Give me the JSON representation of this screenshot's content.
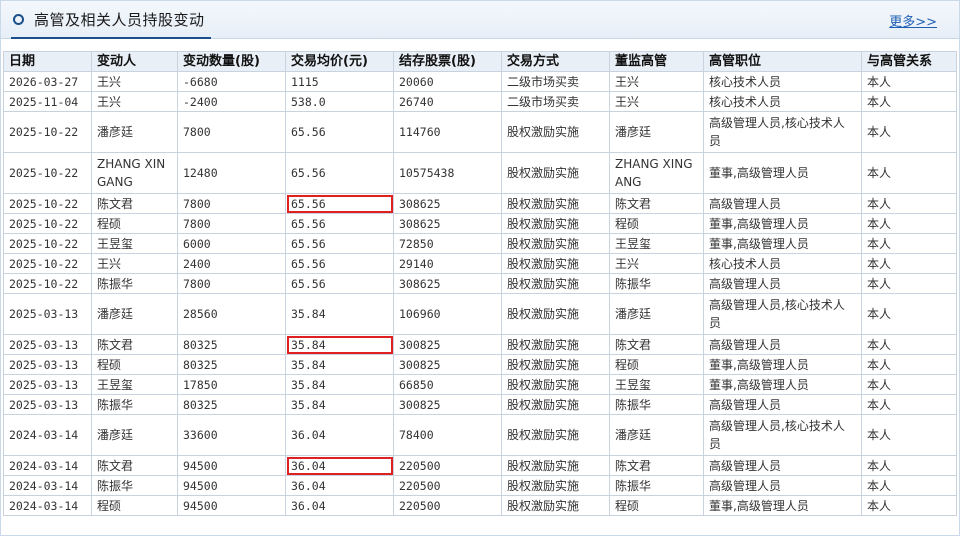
{
  "panel": {
    "title": "高管及相关人员持股变动",
    "more_label": "更多>>"
  },
  "table": {
    "headers": [
      "日期",
      "变动人",
      "变动数量(股)",
      "交易均价(元)",
      "结存股票(股)",
      "交易方式",
      "董监高管",
      "高管职位",
      "与高管关系"
    ],
    "rows": [
      [
        "2026-03-27",
        "王兴",
        "-6680",
        "1115",
        "20060",
        "二级市场买卖",
        "王兴",
        "核心技术人员",
        "本人"
      ],
      [
        "2025-11-04",
        "王兴",
        "-2400",
        "538.0",
        "26740",
        "二级市场买卖",
        "王兴",
        "核心技术人员",
        "本人"
      ],
      [
        "2025-10-22",
        "潘彦廷",
        "7800",
        "65.56",
        "114760",
        "股权激励实施",
        "潘彦廷",
        "高级管理人员,核心技术人员",
        "本人"
      ],
      [
        "2025-10-22",
        "ZHANG XINGANG",
        "12480",
        "65.56",
        "10575438",
        "股权激励实施",
        "ZHANG XINGANG",
        "董事,高级管理人员",
        "本人"
      ],
      [
        "2025-10-22",
        "陈文君",
        "7800",
        "65.56",
        "308625",
        "股权激励实施",
        "陈文君",
        "高级管理人员",
        "本人"
      ],
      [
        "2025-10-22",
        "程硕",
        "7800",
        "65.56",
        "308625",
        "股权激励实施",
        "程硕",
        "董事,高级管理人员",
        "本人"
      ],
      [
        "2025-10-22",
        "王昱玺",
        "6000",
        "65.56",
        "72850",
        "股权激励实施",
        "王昱玺",
        "董事,高级管理人员",
        "本人"
      ],
      [
        "2025-10-22",
        "王兴",
        "2400",
        "65.56",
        "29140",
        "股权激励实施",
        "王兴",
        "核心技术人员",
        "本人"
      ],
      [
        "2025-10-22",
        "陈振华",
        "7800",
        "65.56",
        "308625",
        "股权激励实施",
        "陈振华",
        "高级管理人员",
        "本人"
      ],
      [
        "2025-03-13",
        "潘彦廷",
        "28560",
        "35.84",
        "106960",
        "股权激励实施",
        "潘彦廷",
        "高级管理人员,核心技术人员",
        "本人"
      ],
      [
        "2025-03-13",
        "陈文君",
        "80325",
        "35.84",
        "300825",
        "股权激励实施",
        "陈文君",
        "高级管理人员",
        "本人"
      ],
      [
        "2025-03-13",
        "程硕",
        "80325",
        "35.84",
        "300825",
        "股权激励实施",
        "程硕",
        "董事,高级管理人员",
        "本人"
      ],
      [
        "2025-03-13",
        "王昱玺",
        "17850",
        "35.84",
        "66850",
        "股权激励实施",
        "王昱玺",
        "董事,高级管理人员",
        "本人"
      ],
      [
        "2025-03-13",
        "陈振华",
        "80325",
        "35.84",
        "300825",
        "股权激励实施",
        "陈振华",
        "高级管理人员",
        "本人"
      ],
      [
        "2024-03-14",
        "潘彦廷",
        "33600",
        "36.04",
        "78400",
        "股权激励实施",
        "潘彦廷",
        "高级管理人员,核心技术人员",
        "本人"
      ],
      [
        "2024-03-14",
        "陈文君",
        "94500",
        "36.04",
        "220500",
        "股权激励实施",
        "陈文君",
        "高级管理人员",
        "本人"
      ],
      [
        "2024-03-14",
        "陈振华",
        "94500",
        "36.04",
        "220500",
        "股权激励实施",
        "陈振华",
        "高级管理人员",
        "本人"
      ],
      [
        "2024-03-14",
        "程硕",
        "94500",
        "36.04",
        "220500",
        "股权激励实施",
        "程硕",
        "董事,高级管理人员",
        "本人"
      ]
    ],
    "tall_rows": [
      2,
      3,
      9,
      14
    ],
    "highlighted_cells": [
      [
        4,
        3
      ],
      [
        10,
        3
      ],
      [
        15,
        3
      ]
    ],
    "highlight_color": "#e02020"
  }
}
